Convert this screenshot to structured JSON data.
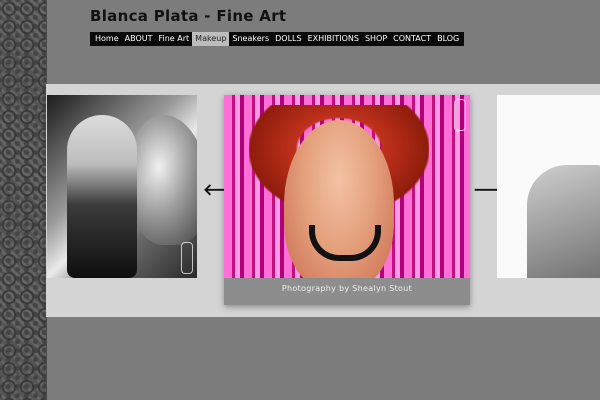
{
  "site": {
    "title": "Blanca Plata - Fine Art"
  },
  "nav": {
    "items": [
      {
        "label": "Home",
        "active": false
      },
      {
        "label": "ABOUT",
        "active": false
      },
      {
        "label": "Fine Art",
        "active": false
      },
      {
        "label": "Makeup",
        "active": true
      },
      {
        "label": "Sneakers",
        "active": false
      },
      {
        "label": "DOLLS",
        "active": false
      },
      {
        "label": "EXHIBITIONS",
        "active": false
      },
      {
        "label": "SHOP",
        "active": false
      },
      {
        "label": "CONTACT",
        "active": false
      },
      {
        "label": "BLOG",
        "active": false
      }
    ]
  },
  "gallery": {
    "caption": "Photography by Shealyn Stout",
    "prev_icon": "arrow-left-icon",
    "next_icon": "arrow-right-icon",
    "prev_glyph": "🡐",
    "next_glyph": "🡒"
  },
  "colors": {
    "page_bg": "#7c7c7c",
    "band_bg": "#d4d4d4",
    "nav_bg": "#0a0a0a",
    "nav_active_bg": "#bdbdbd",
    "caption_bg": "#8d8d8d"
  }
}
